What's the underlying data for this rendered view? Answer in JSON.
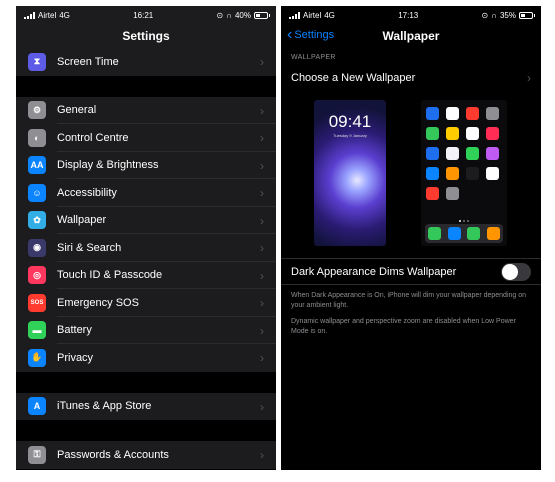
{
  "left": {
    "status": {
      "carrier": "Airtel",
      "network": "4G",
      "time": "16:21",
      "battery": "40%",
      "battery_level": 0.4
    },
    "title": "Settings",
    "groups": [
      [
        {
          "label": "Screen Time",
          "icon": "hourglass-icon",
          "color": "#5e5ce6"
        }
      ],
      [
        {
          "label": "General",
          "icon": "gear-icon",
          "color": "#8e8e93"
        },
        {
          "label": "Control Centre",
          "icon": "switches-icon",
          "color": "#8e8e93"
        },
        {
          "label": "Display & Brightness",
          "icon": "text-size-icon",
          "color": "#0a84ff"
        },
        {
          "label": "Accessibility",
          "icon": "accessibility-icon",
          "color": "#0a84ff"
        },
        {
          "label": "Wallpaper",
          "icon": "flower-icon",
          "color": "#32ade6"
        },
        {
          "label": "Siri & Search",
          "icon": "siri-icon",
          "color": "#3a3a6a"
        },
        {
          "label": "Touch ID & Passcode",
          "icon": "fingerprint-icon",
          "color": "#ff375f"
        },
        {
          "label": "Emergency SOS",
          "icon": "sos-icon",
          "color": "#ff3b30"
        },
        {
          "label": "Battery",
          "icon": "battery-icon",
          "color": "#30d158"
        },
        {
          "label": "Privacy",
          "icon": "hand-icon",
          "color": "#0a84ff"
        }
      ],
      [
        {
          "label": "iTunes & App Store",
          "icon": "app-store-icon",
          "color": "#0a84ff"
        }
      ],
      [
        {
          "label": "Passwords & Accounts",
          "icon": "key-icon",
          "color": "#8e8e93"
        }
      ]
    ]
  },
  "right": {
    "status": {
      "carrier": "Airtel",
      "network": "4G",
      "time": "17:13",
      "battery": "35%",
      "battery_level": 0.35
    },
    "back_label": "Settings",
    "title": "Wallpaper",
    "section_header": "WALLPAPER",
    "choose_label": "Choose a New Wallpaper",
    "lock_time": "09:41",
    "lock_date": "Tuesday 9 January",
    "dark_dims_label": "Dark Appearance Dims Wallpaper",
    "dark_dims_on": false,
    "note1": "When Dark Appearance is On, iPhone will dim your wallpaper depending on your ambient light.",
    "note2": "Dynamic wallpaper and perspective zoom are disabled when Low Power Mode is on.",
    "home_app_colors": [
      "#1e6ff0",
      "#ffffff",
      "#ff3b30",
      "#8e8e93",
      "#34c759",
      "#ffcc00",
      "#ffffff",
      "#ff2d55",
      "#1e6ff0",
      "#f2f2f7",
      "#30d158",
      "#bf5af2",
      "#0a84ff",
      "#ff9500",
      "#1c1c1e",
      "#ffffff",
      "#ff3b30",
      "#8e8e93"
    ],
    "dock_app_colors": [
      "#34c759",
      "#0a84ff",
      "#34c759",
      "#ff9500"
    ]
  }
}
